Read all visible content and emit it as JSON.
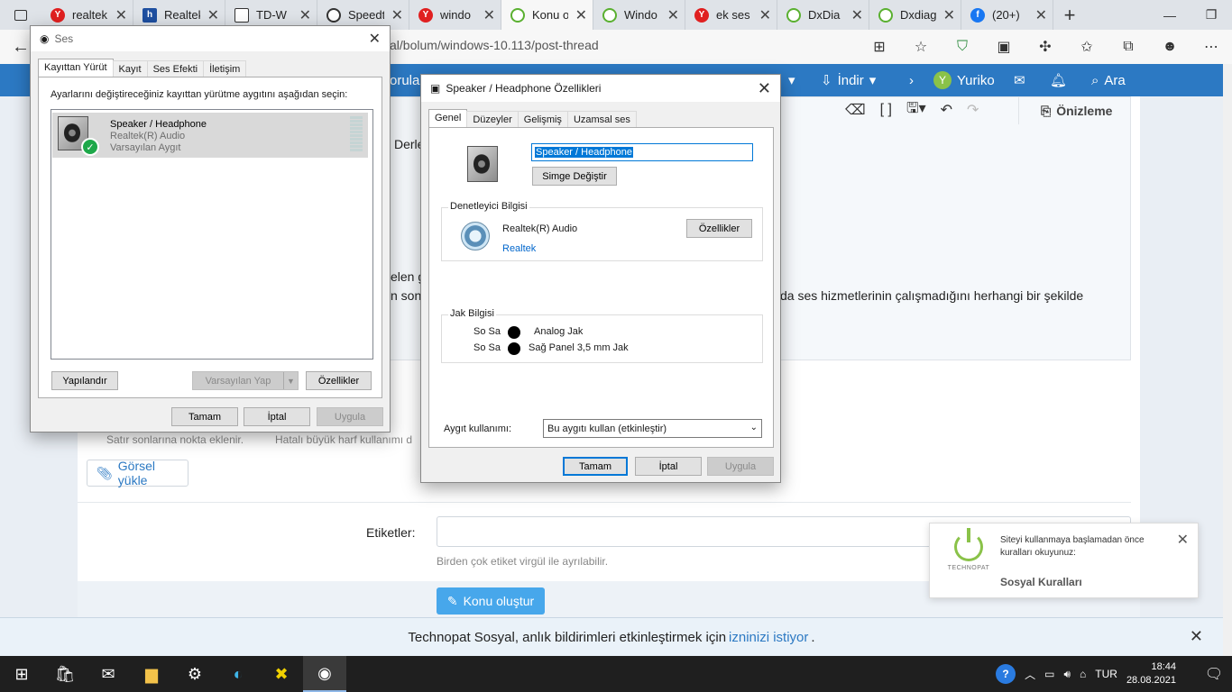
{
  "browser": {
    "tabs": [
      {
        "title": "realtek",
        "fav": "fav-y",
        "fav_text": "Y"
      },
      {
        "title": "Realtek",
        "fav": "fav-r",
        "fav_text": "h"
      },
      {
        "title": "TD-W",
        "fav": "fav-td",
        "fav_text": ""
      },
      {
        "title": "Speedt",
        "fav": "fav-sp",
        "fav_text": ""
      },
      {
        "title": "windo",
        "fav": "fav-y",
        "fav_text": "Y"
      },
      {
        "title": "Konu o",
        "fav": "fav-tp",
        "fav_text": "",
        "active": true
      },
      {
        "title": "Windo",
        "fav": "fav-tp",
        "fav_text": ""
      },
      {
        "title": "ek ses",
        "fav": "fav-y",
        "fav_text": "Y"
      },
      {
        "title": "DxDia",
        "fav": "fav-tp",
        "fav_text": ""
      },
      {
        "title": "Dxdiag",
        "fav": "fav-tp",
        "fav_text": ""
      },
      {
        "title": "(20+)",
        "fav": "fav-fb",
        "fav_text": "f"
      }
    ],
    "url_fragment": "al/bolum/windows-10.113/post-thread"
  },
  "site": {
    "nav_partial": "orular",
    "download": "İndir",
    "user": "Yuriko",
    "user_initial": "Y",
    "search": "Ara",
    "preview": "Önizleme",
    "body_fragments": {
      "derle": "Derle",
      "elen": "elen g",
      "n_son": "n sonı",
      "right_line": "da ses hizmetlerinin çalışmadığını herhangi bir şekilde"
    },
    "hints": {
      "satir": "Satır sonlarına nokta eklenir.",
      "harf": "Hatalı büyük harf kullanımı d"
    },
    "upload": "Görsel yükle",
    "tags_label": "Etiketler:",
    "tags_hint": "Birden çok etiket virgül ile ayrılabilir.",
    "submit": "Konu oluştur",
    "notify": {
      "text": "Technopat Sosyal, anlık bildirimleri etkinleştirmek için",
      "link": "izninizi istiyor",
      "suffix": "."
    },
    "toast": {
      "message": "Siteyi kullanmaya başlamadan önce kuralları okuyunuz:",
      "link": "Sosyal Kuralları",
      "brand": "TECHNOPAT"
    }
  },
  "sound_dialog": {
    "title": "Ses",
    "tabs": [
      "Kayıttan Yürüt",
      "Kayıt",
      "Ses Efekti",
      "İletişim"
    ],
    "instruction": "Ayarlarını değiştireceğiniz kayıttan yürütme aygıtını aşağıdan seçin:",
    "device": {
      "name": "Speaker / Headphone",
      "driver": "Realtek(R) Audio",
      "status": "Varsayılan Aygıt"
    },
    "buttons": {
      "configure": "Yapılandır",
      "set_default": "Varsayılan Yap",
      "properties": "Özellikler",
      "ok": "Tamam",
      "cancel": "İptal",
      "apply": "Uygula"
    }
  },
  "props_dialog": {
    "title": "Speaker / Headphone Özellikleri",
    "tabs": [
      "Genel",
      "Düzeyler",
      "Gelişmiş",
      "Uzamsal ses"
    ],
    "name_value": "Speaker / Headphone",
    "change_icon": "Simge Değiştir",
    "controller_group": "Denetleyici Bilgisi",
    "controller_name": "Realtek(R) Audio",
    "controller_vendor": "Realtek",
    "controller_props": "Özellikler",
    "jack_group": "Jak Bilgisi",
    "jacks": [
      {
        "side": "So Sa",
        "label": "Analog Jak"
      },
      {
        "side": "So Sa",
        "label": "Sağ Panel 3,5 mm Jak"
      }
    ],
    "usage_label": "Aygıt kullanımı:",
    "usage_value": "Bu aygıtı kullan (etkinleştir)",
    "ok": "Tamam",
    "cancel": "İptal",
    "apply": "Uygula"
  },
  "taskbar": {
    "lang": "TUR",
    "time": "18:44",
    "date": "28.08.2021"
  }
}
